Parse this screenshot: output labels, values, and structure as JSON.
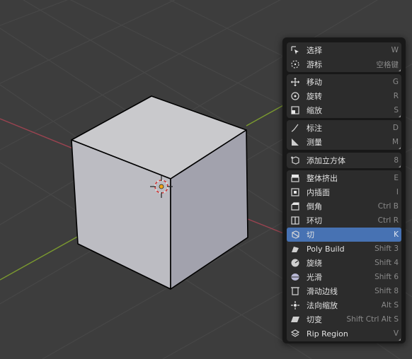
{
  "colors": {
    "viewport_bg": "#3d3d3d",
    "grid": "#474747",
    "x_axis": "#9a4350",
    "y_axis": "#7b9a2f",
    "cube_top": "#c9c9cc",
    "cube_left": "#bcbcc2",
    "cube_right": "#a2a2ad",
    "menu_bg": "#181818",
    "group_bg": "#2c2c2c",
    "highlight": "#4772b3"
  },
  "tool_menu": {
    "groups": [
      {
        "items": [
          {
            "icon": "select-box-icon",
            "label": "选择",
            "shortcut": "W"
          },
          {
            "icon": "cursor-icon",
            "label": "游标",
            "shortcut": "空格键"
          }
        ]
      },
      {
        "items": [
          {
            "icon": "move-icon",
            "label": "移动",
            "shortcut": "G"
          },
          {
            "icon": "rotate-icon",
            "label": "旋转",
            "shortcut": "R"
          },
          {
            "icon": "scale-icon",
            "label": "缩放",
            "shortcut": "S"
          }
        ]
      },
      {
        "items": [
          {
            "icon": "annotate-icon",
            "label": "标注",
            "shortcut": "D"
          },
          {
            "icon": "measure-icon",
            "label": "测量",
            "shortcut": "M"
          }
        ]
      },
      {
        "items": [
          {
            "icon": "add-cube-icon",
            "label": "添加立方体",
            "shortcut": "8"
          }
        ]
      },
      {
        "items": [
          {
            "icon": "extrude-region-icon",
            "label": "整体挤出",
            "shortcut": "E"
          },
          {
            "icon": "inset-faces-icon",
            "label": "内插面",
            "shortcut": "I"
          },
          {
            "icon": "bevel-icon",
            "label": "倒角",
            "shortcut": "Ctrl B"
          },
          {
            "icon": "loop-cut-icon",
            "label": "环切",
            "shortcut": "Ctrl R"
          },
          {
            "icon": "knife-icon",
            "label": "切",
            "shortcut": "K",
            "active": true
          },
          {
            "icon": "poly-build-icon",
            "label": "Poly Build",
            "shortcut": "Shift 3"
          },
          {
            "icon": "spin-icon",
            "label": "旋绕",
            "shortcut": "Shift 4"
          },
          {
            "icon": "smooth-icon",
            "label": "光滑",
            "shortcut": "Shift 6"
          },
          {
            "icon": "edge-slide-icon",
            "label": "滑动边线",
            "shortcut": "Shift 8"
          },
          {
            "icon": "shrink-fatten-icon",
            "label": "法向缩放",
            "shortcut": "Alt S"
          },
          {
            "icon": "shear-icon",
            "label": "切变",
            "shortcut": "Shift Ctrl Alt S"
          },
          {
            "icon": "rip-region-icon",
            "label": "Rip Region",
            "shortcut": "V"
          }
        ]
      }
    ]
  }
}
